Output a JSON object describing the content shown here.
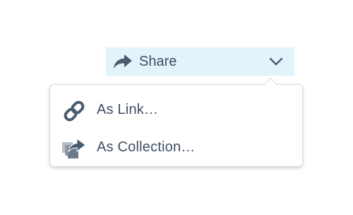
{
  "share_button": {
    "label": "Share",
    "icon": "share-arrow-icon",
    "chevron_icon": "chevron-down-icon"
  },
  "menu": {
    "items": [
      {
        "label": "As Link…",
        "icon": "link-icon"
      },
      {
        "label": "As Collection…",
        "icon": "collection-share-icon"
      }
    ]
  },
  "colors": {
    "button_bg": "#e3f3fc",
    "text": "#3f4f63",
    "icon": "#4a5c70",
    "menu_border": "#d7dadd"
  }
}
